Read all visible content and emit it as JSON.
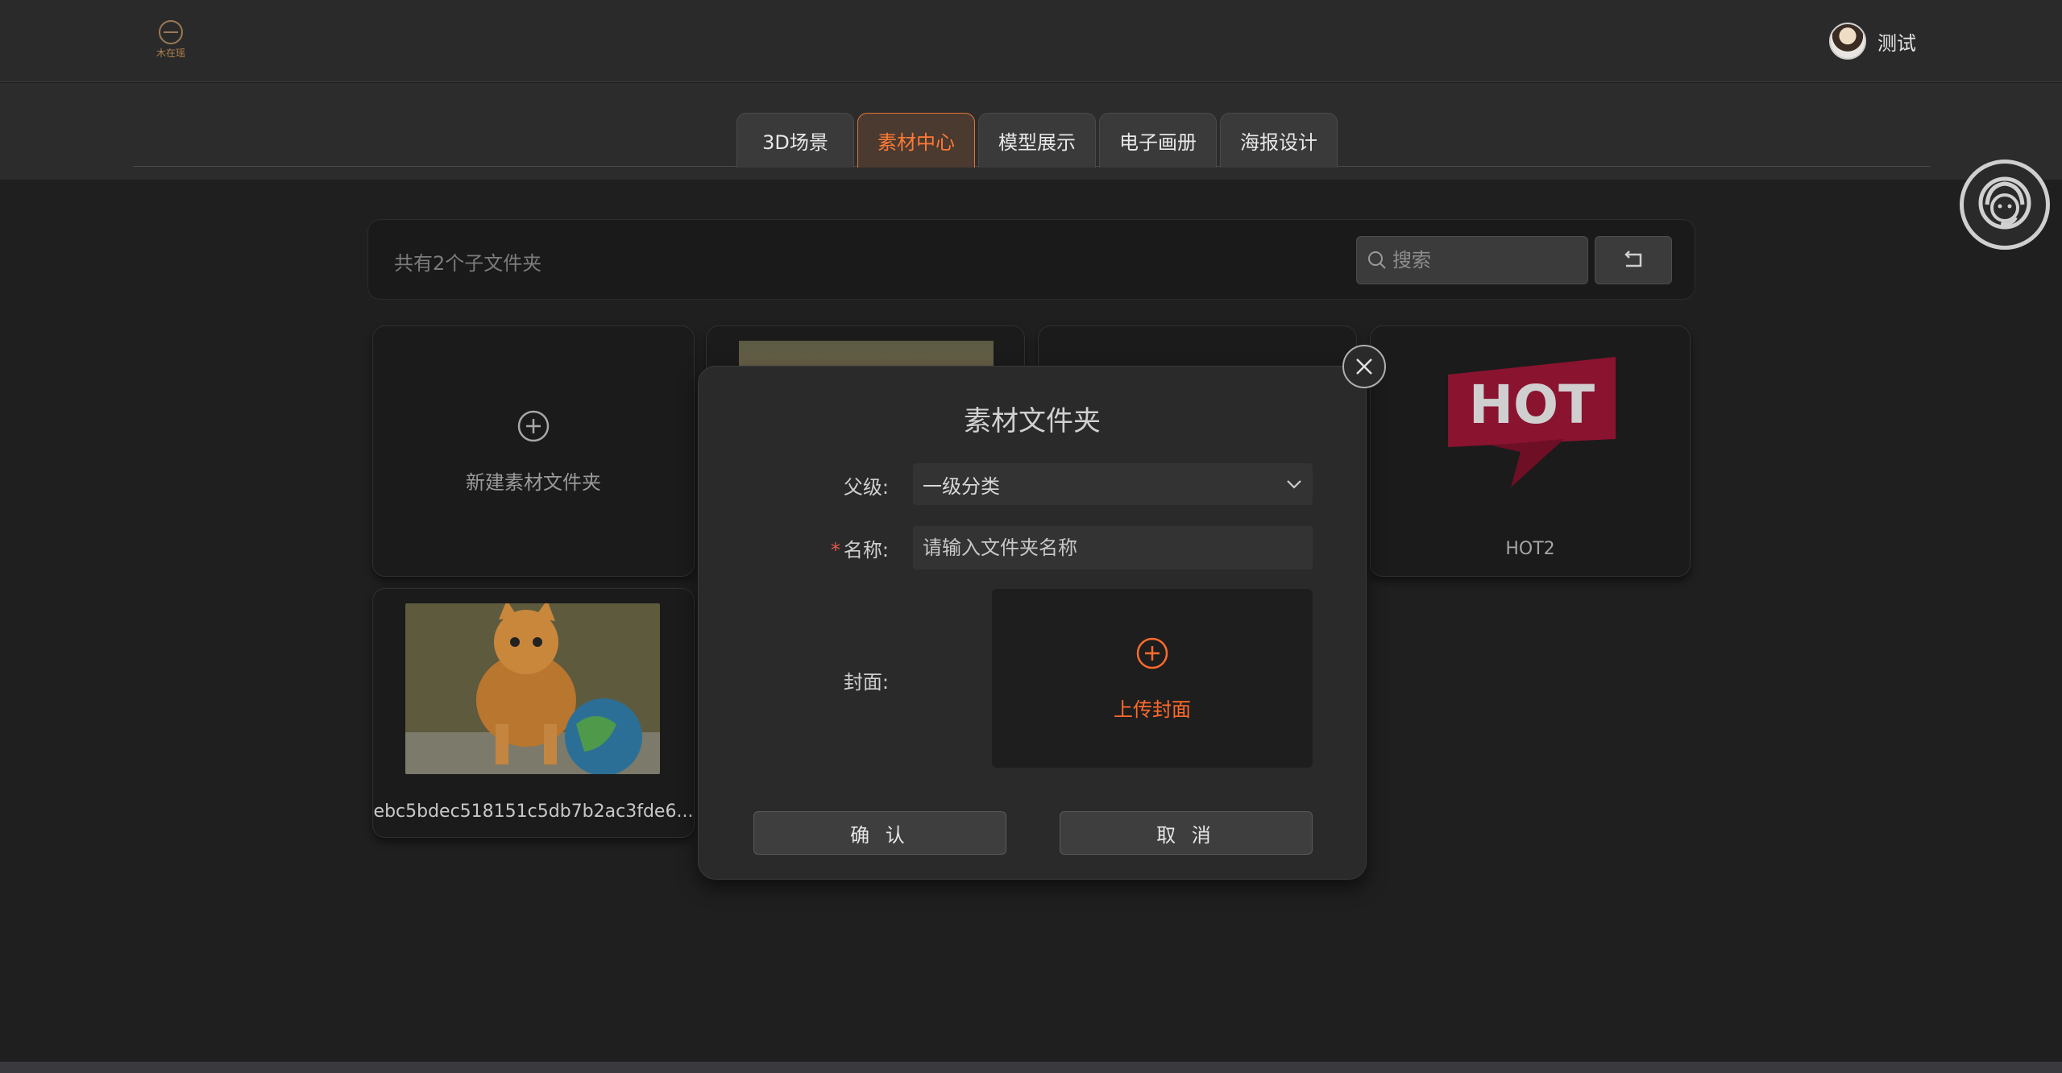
{
  "header": {
    "logo_text": "木在瑶",
    "user_name": "测试"
  },
  "nav": {
    "tabs": [
      {
        "label": "3D场景",
        "active": false
      },
      {
        "label": "素材中心",
        "active": true
      },
      {
        "label": "模型展示",
        "active": false
      },
      {
        "label": "电子画册",
        "active": false
      },
      {
        "label": "海报设计",
        "active": false
      }
    ]
  },
  "toolbar": {
    "count_text": "共有2个子文件夹",
    "search_placeholder": "搜索"
  },
  "cards": {
    "new_label": "新建素材文件夹",
    "hot_badge": "HOT",
    "hot_name": "HOT2",
    "cat_name": "ebc5bdec518151c5db7b2ac3fde6..."
  },
  "modal": {
    "title": "素材文件夹",
    "parent_label": "父级:",
    "parent_value": "一级分类",
    "name_label": "名称:",
    "name_placeholder": "请输入文件夹名称",
    "required_mark": "*",
    "cover_label": "封面:",
    "upload_label": "上传封面",
    "confirm_label": "确 认",
    "cancel_label": "取 消"
  },
  "colors": {
    "accent": "#ff6a2c",
    "background": "#1f1f1f",
    "hot_red": "#8a1330"
  }
}
